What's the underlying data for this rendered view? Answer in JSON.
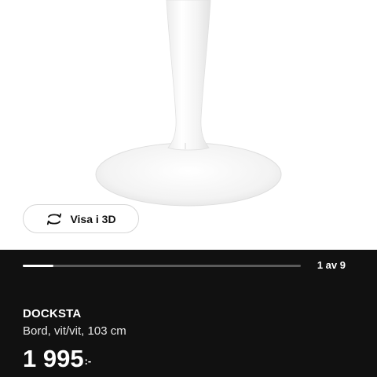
{
  "product_image": {
    "alt_icon": "pedestal-table-image"
  },
  "view_3d": {
    "label": "Visa i 3D",
    "icon": "rotate-3d-icon"
  },
  "gallery": {
    "counter": "1 av 9",
    "progress_fraction": 0.111
  },
  "product": {
    "name": "DOCKSTA",
    "description": "Bord, vit/vit, 103 cm",
    "price_amount": "1 995",
    "price_suffix": ":-"
  },
  "colors": {
    "panel_bg": "#111111",
    "text": "#ffffff",
    "progress_track": "#5a5a5a"
  }
}
